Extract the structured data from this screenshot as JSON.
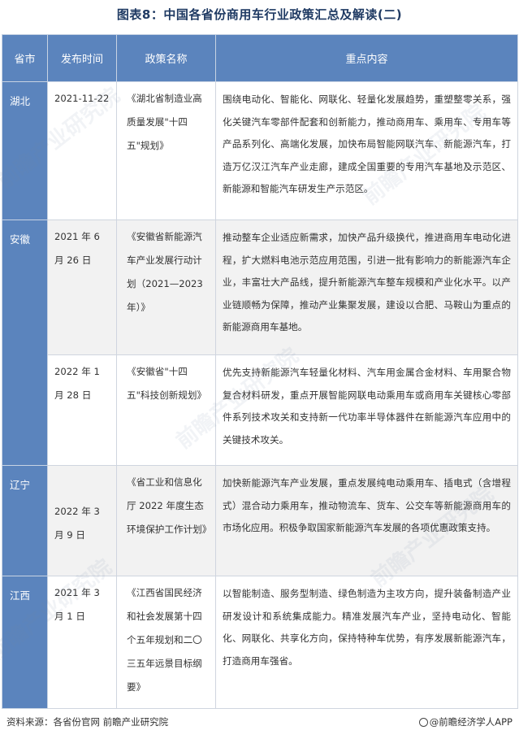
{
  "page_title": "图表8：中国各省份商用车行业政策汇总及解读(二)",
  "table": {
    "headers": [
      "省市",
      "发布时间",
      "政策名称",
      "重点内容"
    ],
    "rows": [
      {
        "province": "湖北",
        "date": "2021-11-22",
        "name": "《湖北省制造业高质量发展\"十四五\"规划》",
        "content": "围绕电动化、智能化、网联化、轻量化发展趋势，重塑整零关系，强化关键汽车零部件配套和创新能力，推动商用车、乘用车、专用车等产品系列化、高端化发展，加快布局智能网联汽车、新能源汽车，打造万亿汉江汽车产业走廊，建成全国重要的专用汽车基地及示范区、新能源和智能汽车研发生产示范区。"
      },
      {
        "province": "安徽",
        "date": "2021 年 6 月 26 日",
        "name": "《安徽省新能源汽车产业发展行动计划（2021—2023年）》",
        "content": "推动整车企业适应新需求，加快产品升级换代，推进商用车电动化进程，扩大燃料电池示范应用范围，引进一批有影响力的新能源汽车企业，丰富壮大产品线，提升新能源汽车整车规模和产业化水平。以产业链顺畅为保障，推动产业集聚发展，建设以合肥、马鞍山为重点的新能源商用车基地。"
      },
      {
        "province": "",
        "date": "2022 年 1 月 28 日",
        "name": "《安徽省\"十四五\"科技创新规划》",
        "content": "优先支持新能源汽车轻量化材料、汽车用金属合金材料、车用聚合物复合材料研发，重点开展智能网联电动乘用车或商用车关键核心零部件系列技术攻关和支持新一代功率半导体器件在新能源汽车应用中的关键技术攻关。"
      },
      {
        "province": "辽宁",
        "date": "2022 年 3 月 9 日",
        "name": "《省工业和信息化厅 2022 年度生态环境保护工作计划》",
        "content": "加快新能源汽车产业发展，重点发展纯电动乘用车、插电式（含增程式）混合动力乘用车，推动物流车、货车、公交车等新能源商用车的市场化应用。积极争取国家新能源汽车发展的各项优惠政策支持。"
      },
      {
        "province": "江西",
        "date": "2021 年 3 月 1 日",
        "name": "《江西省国民经济和社会发展第十四个五年规划和二〇三五年远景目标纲要》",
        "content": "以智能制造、服务型制造、绿色制造为主攻方向，提升装备制造产业研发设计和系统集成能力。精准发展汽车产业，坚持电动化、智能化、网联化、共享化方向，保持特种车优势，有序发展新能源汽车，打造商用车强省。"
      }
    ]
  },
  "footer": {
    "source": "资料来源：各省份官网 前瞻产业研究院",
    "brand": "@前瞻经济学人APP"
  },
  "watermark": {
    "text": "前瞻产业研究院"
  },
  "colors": {
    "header_bg": "#5b84bd",
    "title_color": "#1f3a63",
    "shade_row": "#f2f2f2"
  }
}
